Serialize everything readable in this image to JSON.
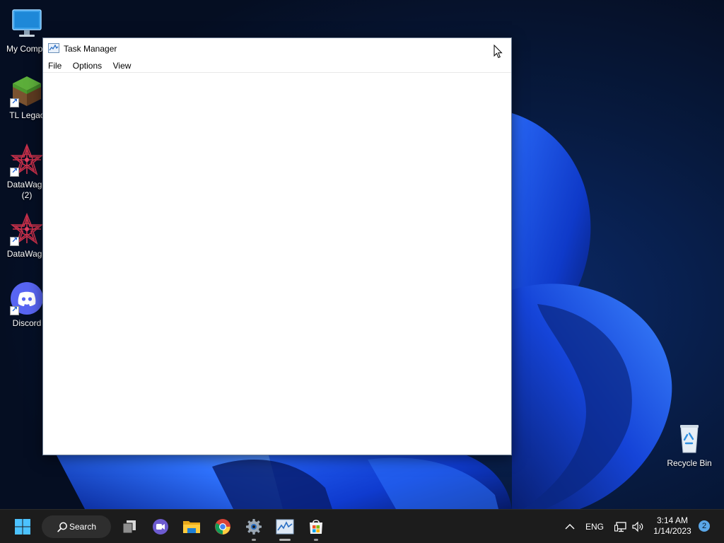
{
  "desktop": {
    "icons": [
      {
        "label": "My Compu",
        "icon": "monitor-icon"
      },
      {
        "label": "TL Legac",
        "icon": "grass-block-icon"
      },
      {
        "label": "DataWago",
        "label2": "(2)",
        "icon": "starburst-icon"
      },
      {
        "label": "DataWago",
        "icon": "starburst-icon"
      },
      {
        "label": "Discord",
        "icon": "discord-icon"
      },
      {
        "label": "Recycle Bin",
        "icon": "recycle-bin-icon"
      }
    ]
  },
  "window": {
    "title": "Task Manager",
    "menu": [
      "File",
      "Options",
      "View"
    ]
  },
  "taskbar": {
    "search_label": "Search",
    "apps": [
      "start-icon",
      "task-view-icon",
      "teams-chat-icon",
      "file-explorer-icon",
      "chrome-icon",
      "settings-icon",
      "task-manager-icon",
      "store-icon"
    ],
    "tray": {
      "language": "ENG",
      "time": "3:14 AM",
      "date": "1/14/2023",
      "notifications": "2"
    }
  },
  "colors": {
    "taskbar_bg": "#1c1c1c",
    "wallpaper_dark": "#061226",
    "wallpaper_accent": "#1a4dff"
  }
}
